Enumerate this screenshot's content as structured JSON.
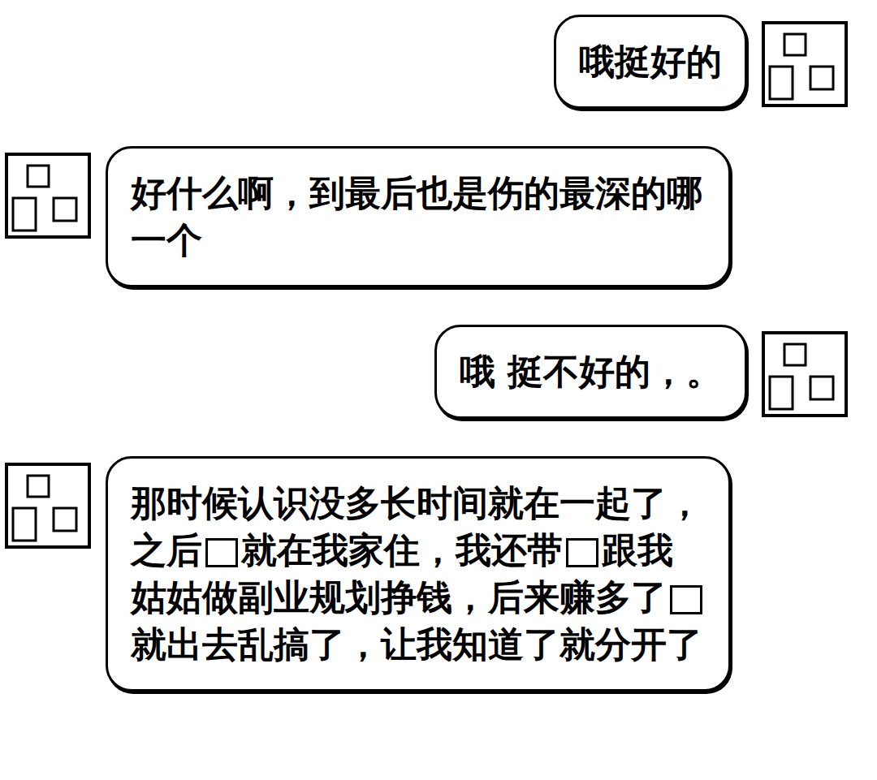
{
  "messages": [
    {
      "side": "right",
      "segments": [
        {
          "kind": "text",
          "text": "哦挺好的"
        }
      ]
    },
    {
      "side": "left",
      "segments": [
        {
          "kind": "text",
          "text": "好什么啊，到最后也是伤的最深的哪一个"
        }
      ]
    },
    {
      "side": "right",
      "segments": [
        {
          "kind": "text",
          "text": "哦 挺不好的，。"
        }
      ]
    },
    {
      "side": "left",
      "segments": [
        {
          "kind": "text",
          "text": "那时候认识没多长时间就在一起了，之后"
        },
        {
          "kind": "redacted"
        },
        {
          "kind": "text",
          "text": "就在我家住，我还带"
        },
        {
          "kind": "redacted"
        },
        {
          "kind": "text",
          "text": "跟我姑姑做副业规划挣钱，后来赚多了"
        },
        {
          "kind": "redacted"
        },
        {
          "kind": "text",
          "text": "就出去乱搞了，让我知道了就分开了"
        }
      ]
    }
  ]
}
